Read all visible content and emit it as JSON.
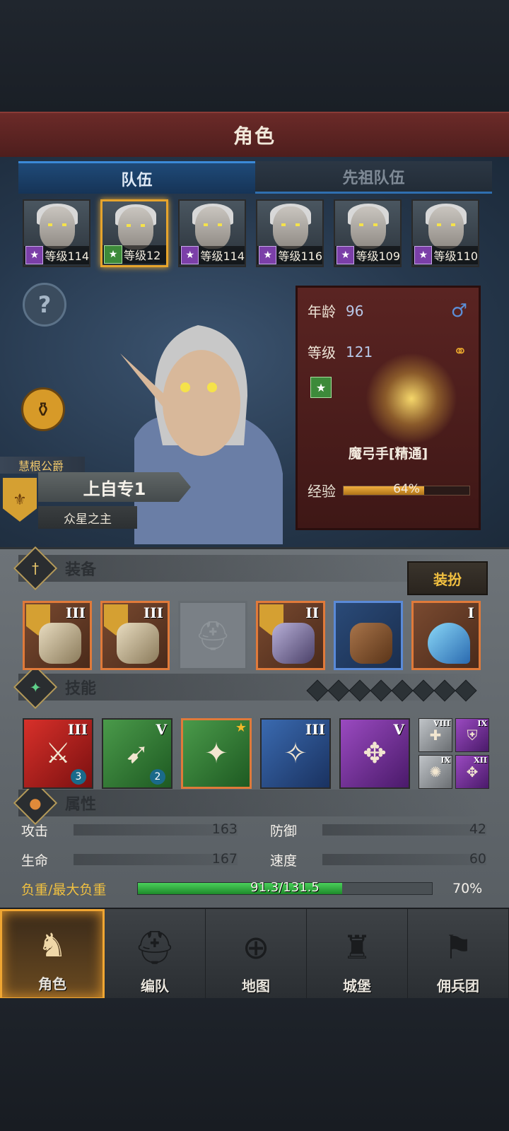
{
  "header": {
    "title": "角色"
  },
  "tabs": [
    {
      "label": "队伍",
      "active": true
    },
    {
      "label": "先祖队伍",
      "active": false
    }
  ],
  "portraits": [
    {
      "level": "等级114",
      "class_color": "purple",
      "selected": false
    },
    {
      "level": "等级12",
      "class_color": "green",
      "selected": true
    },
    {
      "level": "等级114",
      "class_color": "purple",
      "selected": false
    },
    {
      "level": "等级116",
      "class_color": "purple",
      "selected": false
    },
    {
      "level": "等级109",
      "class_color": "purple",
      "selected": false
    },
    {
      "level": "等级110",
      "class_color": "purple",
      "selected": false
    }
  ],
  "hero": {
    "title_small": "慧根公爵",
    "name": "上自专1",
    "subtitle": "众星之主"
  },
  "info": {
    "age_label": "年龄",
    "age": "96",
    "level_label": "等级",
    "level": "121",
    "class_name": "魔弓手[精通]",
    "exp_label": "经验",
    "exp_pct_text": "64%",
    "exp_fraction": 0.64,
    "gender_symbol": "♂"
  },
  "equipment": {
    "title": "装备",
    "dress_button": "装扮",
    "slots": [
      {
        "tier": "III",
        "style": "orange",
        "empty": false
      },
      {
        "tier": "III",
        "style": "orange",
        "empty": false
      },
      {
        "tier": "",
        "style": "empty",
        "empty": true
      },
      {
        "tier": "II",
        "style": "orange",
        "empty": false
      },
      {
        "tier": "",
        "style": "blue",
        "empty": false
      },
      {
        "tier": "I",
        "style": "orange",
        "empty": false
      }
    ]
  },
  "skills": {
    "title": "技能",
    "slots": [
      {
        "tier": "III",
        "style": "red",
        "count": "3",
        "glyph": "⚔"
      },
      {
        "tier": "V",
        "style": "green",
        "count": "2",
        "glyph": "➹"
      },
      {
        "tier": "",
        "style": "green2",
        "count": "",
        "glyph": "✦",
        "star": "★"
      },
      {
        "tier": "III",
        "style": "blue",
        "count": "",
        "glyph": "✧"
      },
      {
        "tier": "V",
        "style": "purple",
        "count": "",
        "glyph": "✥"
      }
    ],
    "mini": [
      {
        "tier": "VIII",
        "style": "gray",
        "glyph": "✚"
      },
      {
        "tier": "IX",
        "style": "purple",
        "glyph": "⛨"
      },
      {
        "tier": "IX",
        "style": "gray",
        "glyph": "✺"
      },
      {
        "tier": "XII",
        "style": "purple",
        "glyph": "✥"
      }
    ]
  },
  "attributes": {
    "title": "属性",
    "attack_label": "攻击",
    "attack": "163",
    "defense_label": "防御",
    "defense": "42",
    "hp_label": "生命",
    "hp": "167",
    "speed_label": "速度",
    "speed": "60",
    "weight_label": "负重/最大负重",
    "weight_text": "91.3/131.5",
    "weight_fraction": 0.694,
    "weight_pct": "70%"
  },
  "nav": [
    {
      "label": "角色",
      "icon": "knight-icon",
      "glyph": "♞",
      "active": true
    },
    {
      "label": "编队",
      "icon": "helmet-icon",
      "glyph": "⛑",
      "active": false
    },
    {
      "label": "地图",
      "icon": "compass-icon",
      "glyph": "⊕",
      "active": false
    },
    {
      "label": "城堡",
      "icon": "castle-icon",
      "glyph": "♜",
      "active": false
    },
    {
      "label": "佣兵团",
      "icon": "banner-icon",
      "glyph": "⚑",
      "active": false
    }
  ],
  "colors": {
    "accent_gold": "#f0a632",
    "title_red": "#6b2a28",
    "tab_blue": "#1f4a78"
  }
}
